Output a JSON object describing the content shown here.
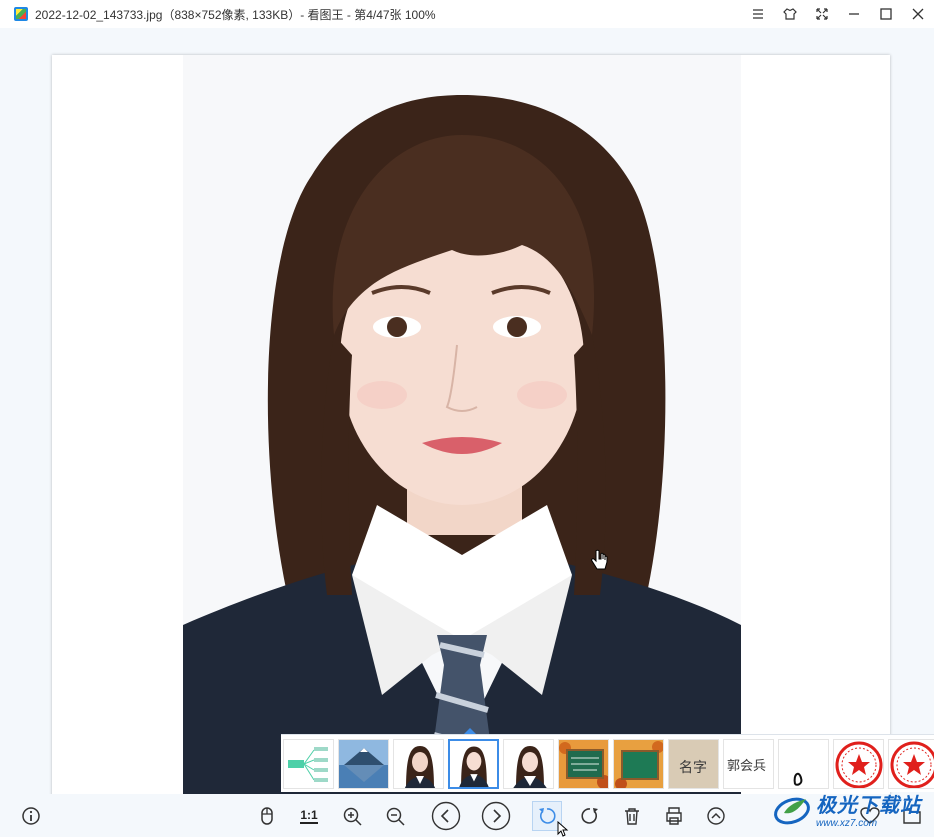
{
  "window": {
    "title": "2022-12-02_143733.jpg（838×752像素, 133KB）- 看图王 - 第4/47张 100%",
    "controls": [
      "menu-icon",
      "skin-icon",
      "fullscreen-icon",
      "minimize-icon",
      "maximize-icon",
      "close-icon"
    ]
  },
  "thumbnails": [
    {
      "kind": "mindmap"
    },
    {
      "kind": "mountain-lake"
    },
    {
      "kind": "portrait"
    },
    {
      "kind": "portrait",
      "active": true
    },
    {
      "kind": "portrait"
    },
    {
      "kind": "chalkboard-leaves"
    },
    {
      "kind": "chalkboard-leaves"
    },
    {
      "kind": "handwriting",
      "text": "名字"
    },
    {
      "kind": "handwriting",
      "text": "郭会兵"
    },
    {
      "kind": "signature"
    },
    {
      "kind": "red-seal"
    },
    {
      "kind": "red-seal"
    }
  ],
  "toolbar": {
    "ratio_label": "1:1",
    "buttons": [
      "info-icon",
      "mouse-icon",
      "actual-size",
      "zoom-in-icon",
      "zoom-out-icon",
      "prev-icon",
      "next-icon",
      "rotate-left-icon",
      "rotate-right-icon",
      "delete-icon",
      "print-icon",
      "expand-icon",
      "favorite-icon",
      "folder-icon"
    ]
  },
  "watermark": {
    "main": "极光下载站",
    "sub": "www.xz7.com"
  },
  "colors": {
    "accent": "#3c8ce7",
    "background": "#f4f8fc",
    "watermark": "#1565c0"
  }
}
